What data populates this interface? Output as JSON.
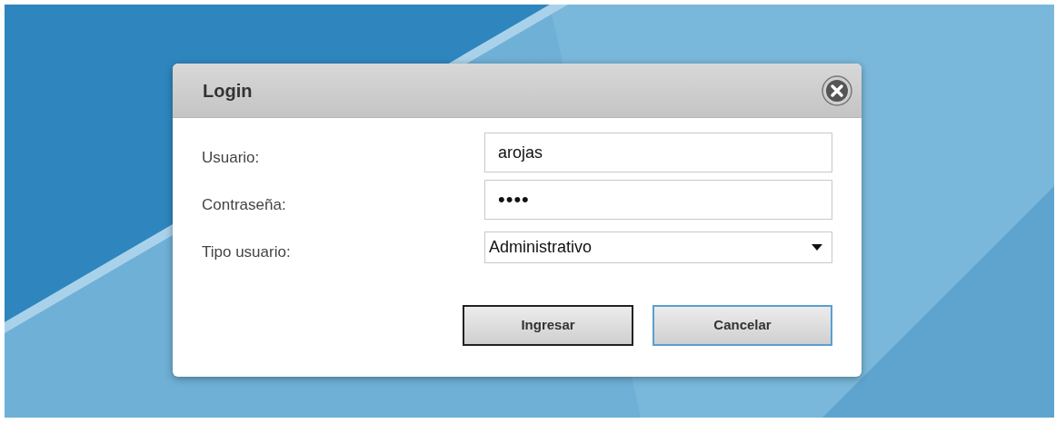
{
  "dialog": {
    "title": "Login"
  },
  "fields": [
    {
      "kind": "text",
      "label": "Usuario:",
      "value": "arojas"
    },
    {
      "kind": "password",
      "label": "Contraseña:",
      "value": "••••"
    },
    {
      "kind": "select",
      "label": "Tipo usuario:",
      "value": "Administrativo"
    }
  ],
  "buttons": [
    {
      "label": "Ingresar",
      "kind": "default"
    },
    {
      "label": "Cancelar",
      "kind": "hover"
    }
  ]
}
